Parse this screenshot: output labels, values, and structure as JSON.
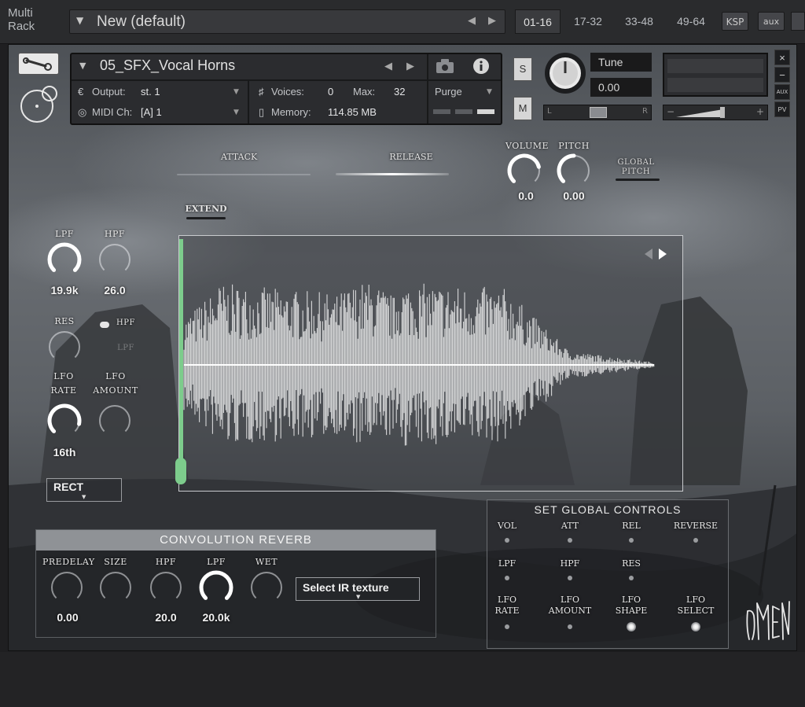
{
  "rack": {
    "label_line1": "Multi",
    "label_line2": "Rack",
    "preset_name": "New (default)",
    "tabs": [
      {
        "label": "01-16",
        "active": true
      },
      {
        "label": "17-32",
        "active": false
      },
      {
        "label": "33-48",
        "active": false
      },
      {
        "label": "49-64",
        "active": false
      }
    ],
    "ksp_label": "KSP",
    "aux_label": "aux"
  },
  "instrument": {
    "name": "05_SFX_Vocal Horns",
    "output_label": "Output:",
    "output_value": "st. 1",
    "voices_label": "Voices:",
    "voices_value": "0",
    "max_label": "Max:",
    "max_value": "32",
    "purge_label": "Purge",
    "midi_label": "MIDI Ch:",
    "midi_value": "[A]  1",
    "memory_label": "Memory:",
    "memory_value": "114.85 MB",
    "solo_label": "S",
    "mute_label": "M",
    "tune_label": "Tune",
    "tune_value": "0.00",
    "side_close": "×",
    "side_min": "−",
    "side_aux": "AUX",
    "side_pv": "PV"
  },
  "envelope": {
    "attack_label": "ATTACK",
    "release_label": "RELEASE",
    "extend_label": "EXTEND"
  },
  "global": {
    "volume_label": "VOLUME",
    "volume_value": "0.0",
    "volume_level": 0.78,
    "pitch_label": "PITCH",
    "pitch_value": "0.00",
    "pitch_level": 0.5,
    "global_pitch_line1": "GLOBAL",
    "global_pitch_line2": "PITCH"
  },
  "filter": {
    "lpf_label": "LPF",
    "lpf_value": "19.9k",
    "lpf_level": 1.0,
    "hpf_label": "HPF",
    "hpf_value": "26.0",
    "hpf_level": 0.0,
    "res_label": "RES",
    "res_level": 0.0,
    "toggle_hpf": "HPF",
    "toggle_lpf": "LPF",
    "lfo_rate_line1": "LFO",
    "lfo_rate_line2": "RATE",
    "lfo_rate_value": "16th",
    "lfo_rate_level": 0.88,
    "lfo_amount_line1": "LFO",
    "lfo_amount_line2": "AMOUNT",
    "lfo_amount_level": 0.0,
    "shape_value": "RECT"
  },
  "reverb": {
    "title": "CONVOLUTION  REVERB",
    "predelay_label": "PREDELAY",
    "predelay_value": "0.00",
    "predelay_level": 0.0,
    "size_label": "SIZE",
    "size_level": 0.0,
    "hpf_label": "HPF",
    "hpf_value": "20.0",
    "hpf_level": 0.0,
    "lpf_label": "LPF",
    "lpf_value": "20.0k",
    "lpf_level": 1.0,
    "wet_label": "WET",
    "wet_level": 0.0,
    "ir_label": "Select IR texture"
  },
  "global_controls": {
    "title": "SET GLOBAL CONTROLS",
    "row1": [
      "VOL",
      "ATT",
      "REL",
      "REVERSE"
    ],
    "row2": [
      "LPF",
      "HPF",
      "RES"
    ],
    "row3": [
      {
        "line1": "LFO",
        "line2": "RATE",
        "on": false
      },
      {
        "line1": "LFO",
        "line2": "AMOUNT",
        "on": false
      },
      {
        "line1": "LFO",
        "line2": "SHAPE",
        "on": true
      },
      {
        "line1": "LFO",
        "line2": "SELECT",
        "on": true
      }
    ]
  },
  "colors": {
    "playhead": "#7dcc8c",
    "waveform": "#ffffff",
    "accent_knob": "#ffffff"
  }
}
